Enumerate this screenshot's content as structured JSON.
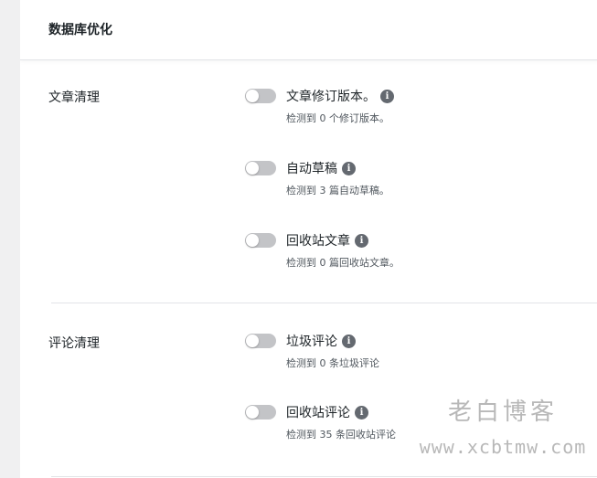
{
  "panel": {
    "title": "数据库优化"
  },
  "sections": [
    {
      "label": "文章清理",
      "options": [
        {
          "label": "文章修订版本。",
          "desc": "检测到 0 个修订版本。",
          "enabled": false
        },
        {
          "label": "自动草稿",
          "desc": "检测到 3 篇自动草稿。",
          "enabled": false
        },
        {
          "label": "回收站文章",
          "desc": "检测到 0 篇回收站文章。",
          "enabled": false
        }
      ]
    },
    {
      "label": "评论清理",
      "options": [
        {
          "label": "垃圾评论",
          "desc": "检测到 0 条垃圾评论",
          "enabled": false
        },
        {
          "label": "回收站评论",
          "desc": "检测到 35 条回收站评论",
          "enabled": false
        }
      ]
    }
  ],
  "icons": {
    "info": "i"
  },
  "watermark": {
    "title": "老白博客",
    "url": "www.xcbtmw.com"
  }
}
